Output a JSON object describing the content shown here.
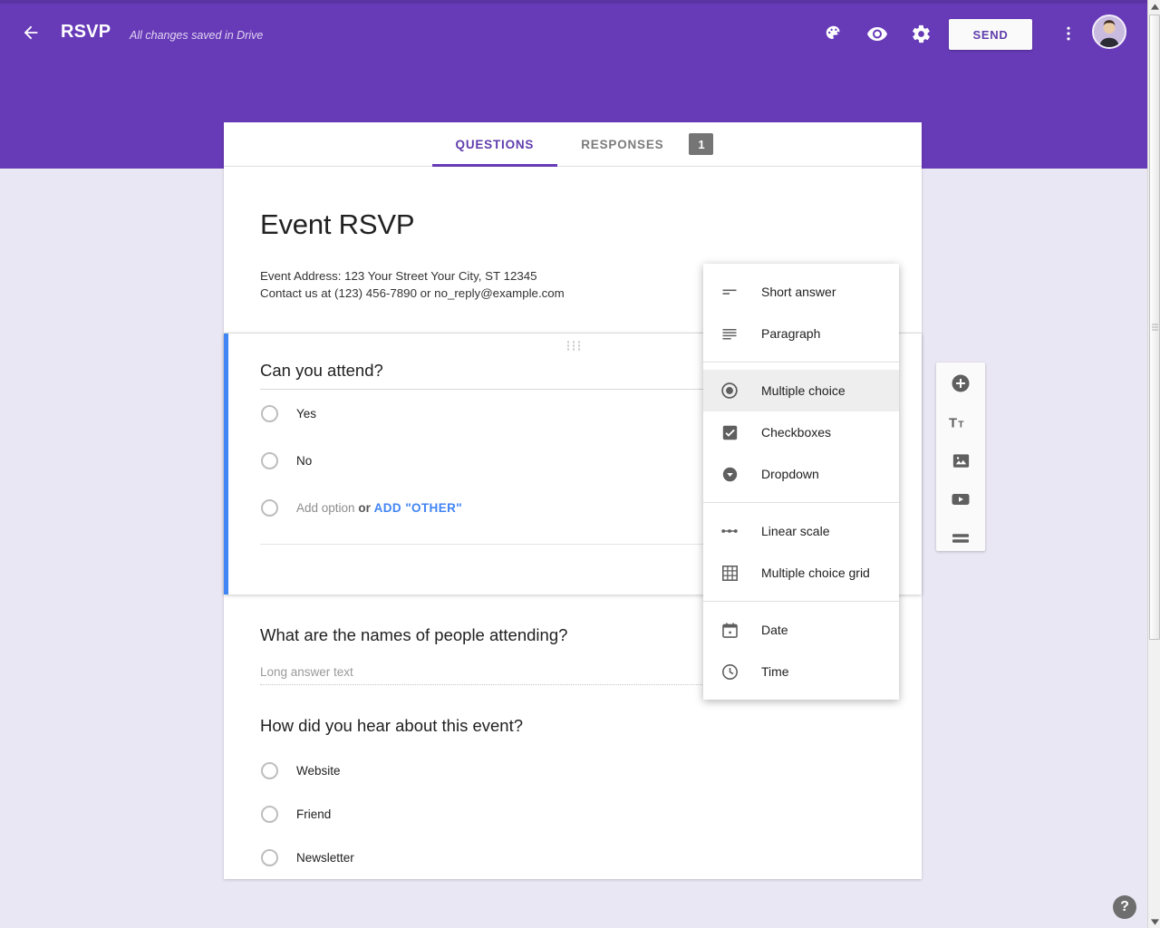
{
  "appbar": {
    "back_icon": "back-arrow-icon",
    "doc_title": "RSVP",
    "save_state": "All changes saved in Drive",
    "palette_icon": "palette-icon",
    "preview_icon": "eye-preview-icon",
    "settings_icon": "gear-settings-icon",
    "send_label": "SEND",
    "more_icon": "kebab-more-icon",
    "avatar_name": "user-avatar",
    "bg_color": "#673ab7"
  },
  "tabs": [
    {
      "label": "QUESTIONS",
      "active": true,
      "badge": null
    },
    {
      "label": "RESPONSES",
      "active": false,
      "badge": "1"
    }
  ],
  "form": {
    "title": "Event RSVP",
    "description_line1": "Event Address: 123 Your Street Your City, ST 12345",
    "description_line2": "Contact us at (123) 456-7890 or no_reply@example.com"
  },
  "questions": [
    {
      "title": "Can you attend?",
      "type": "multiple-choice",
      "active": true,
      "image_icon": "image-icon",
      "options": [
        "Yes",
        "No"
      ],
      "add_option_text": "Add option",
      "add_option_or": "or",
      "add_other_label": "ADD \"OTHER\"",
      "duplicate_icon": "duplicate-icon"
    },
    {
      "title": "What are the names of people attending?",
      "type": "paragraph",
      "active": false,
      "placeholder": "Long answer text"
    },
    {
      "title": "How did you hear about this event?",
      "type": "multiple-choice",
      "active": false,
      "options": [
        "Website",
        "Friend",
        "Newsletter"
      ]
    }
  ],
  "side_toolbar": [
    {
      "name": "add-question-button",
      "icon": "plus-circle-icon"
    },
    {
      "name": "add-title-button",
      "icon": "title-text-icon"
    },
    {
      "name": "add-image-button",
      "icon": "image-icon"
    },
    {
      "name": "add-video-button",
      "icon": "video-icon"
    },
    {
      "name": "add-section-button",
      "icon": "section-icon"
    }
  ],
  "type_menu": {
    "groups": [
      [
        {
          "label": "Short answer",
          "icon": "short-answer-icon",
          "selected": false
        },
        {
          "label": "Paragraph",
          "icon": "paragraph-icon",
          "selected": false
        }
      ],
      [
        {
          "label": "Multiple choice",
          "icon": "radio-icon",
          "selected": true
        },
        {
          "label": "Checkboxes",
          "icon": "checkbox-icon",
          "selected": false
        },
        {
          "label": "Dropdown",
          "icon": "dropdown-icon",
          "selected": false
        }
      ],
      [
        {
          "label": "Linear scale",
          "icon": "linear-scale-icon",
          "selected": false
        },
        {
          "label": "Multiple choice grid",
          "icon": "grid-icon",
          "selected": false
        }
      ],
      [
        {
          "label": "Date",
          "icon": "calendar-icon",
          "selected": false
        },
        {
          "label": "Time",
          "icon": "clock-icon",
          "selected": false
        }
      ]
    ]
  },
  "help": {
    "label": "?"
  },
  "colors": {
    "accent_purple": "#673ab7",
    "page_background": "#eae7f4",
    "link_blue": "#4285f4",
    "active_card_bar": "#4285f4"
  }
}
